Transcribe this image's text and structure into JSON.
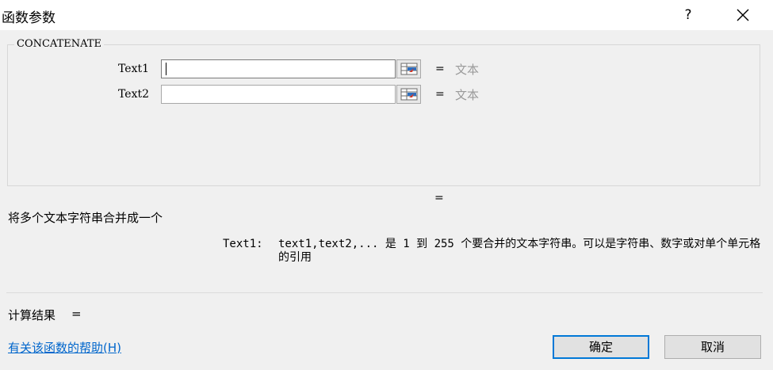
{
  "dialog": {
    "title": "函数参数",
    "help_button": "?",
    "function_name": "CONCATENATE"
  },
  "arguments": [
    {
      "label": "Text1",
      "value": "",
      "equals": "=",
      "type_hint": "文本"
    },
    {
      "label": "Text2",
      "value": "",
      "equals": "=",
      "type_hint": "文本"
    }
  ],
  "result_equals": "=",
  "description": "将多个文本字符串合并成一个",
  "argument_help": {
    "name": "Text1:",
    "text": "text1,text2,... 是 1 到 255 个要合并的文本字符串。可以是字符串、数字或对单个单元格的引用"
  },
  "calculation": {
    "label": "计算结果",
    "equals": "="
  },
  "help_link": "有关该函数的帮助(H)",
  "buttons": {
    "ok": "确定",
    "cancel": "取消"
  },
  "icons": {
    "close": "close-icon",
    "collapse": "range-select-icon"
  }
}
